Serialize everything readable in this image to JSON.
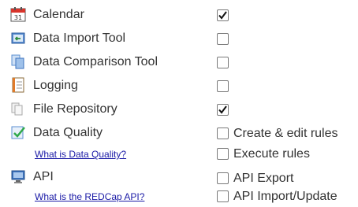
{
  "rights": {
    "calendar": {
      "label": "Calendar",
      "icon": "calendar-icon",
      "checked": true
    },
    "data_import": {
      "label": "Data Import Tool",
      "icon": "import-icon",
      "checked": false
    },
    "data_comparison": {
      "label": "Data Comparison Tool",
      "icon": "compare-icon",
      "checked": false
    },
    "logging": {
      "label": "Logging",
      "icon": "logging-icon",
      "checked": false
    },
    "file_repository": {
      "label": "File Repository",
      "icon": "file-repository-icon",
      "checked": true
    },
    "data_quality": {
      "label": "Data Quality",
      "icon": "data-quality-icon",
      "help_link": "What is Data Quality?",
      "options": [
        {
          "label": "Create & edit rules",
          "checked": false
        },
        {
          "label": "Execute rules",
          "checked": false
        }
      ]
    },
    "api": {
      "label": "API",
      "icon": "api-icon",
      "help_link": "What is the REDCap API?",
      "options": [
        {
          "label": "API Export",
          "checked": false
        },
        {
          "label": "API Import/Update",
          "checked": false
        }
      ]
    }
  },
  "colors": {
    "link": "#1a1aa6",
    "text": "#333333",
    "checkbox_border": "#7a7a7a"
  }
}
